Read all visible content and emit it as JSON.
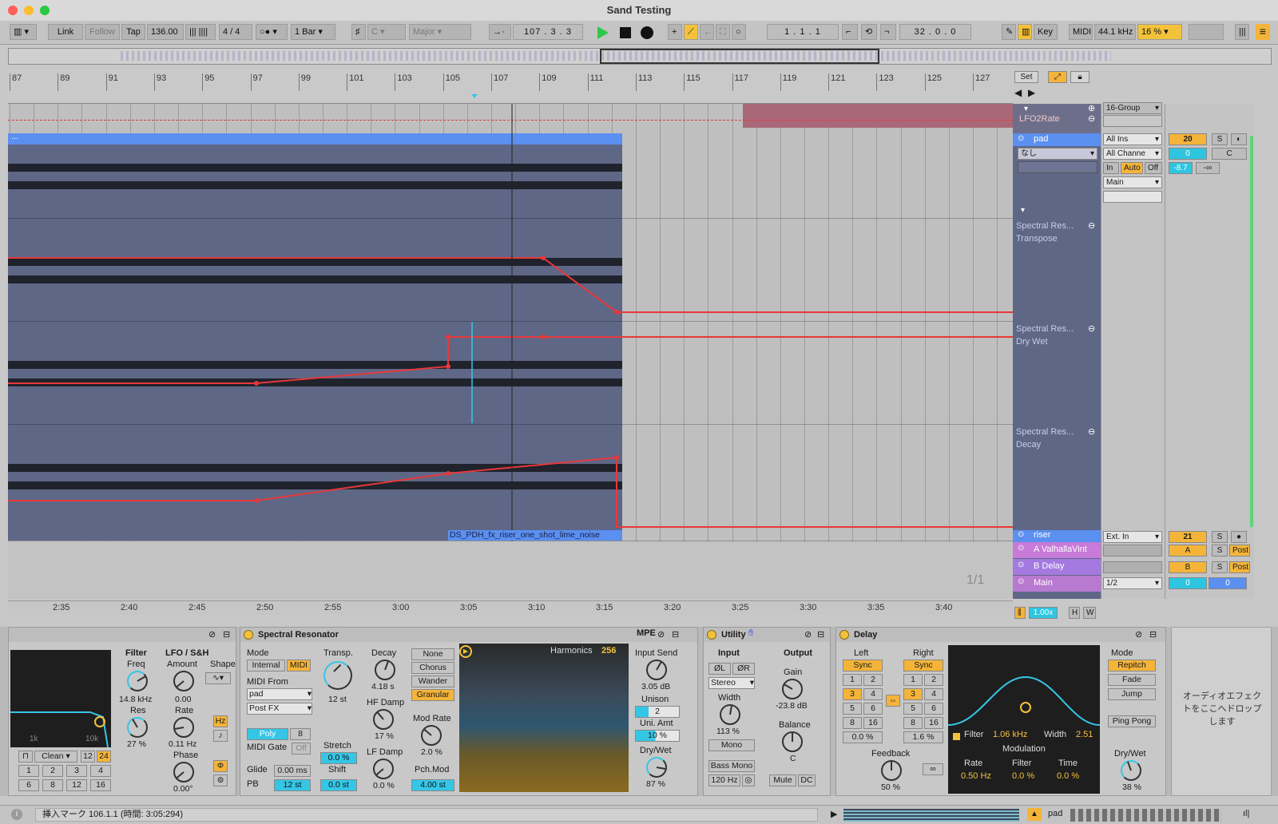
{
  "window": {
    "title": "Sand Testing"
  },
  "control_bar": {
    "link": "Link",
    "follow": "Follow",
    "tap": "Tap",
    "tempo": "136.00",
    "signature": "4 / 4",
    "quantize": "1 Bar",
    "key": "C",
    "scale": "Major",
    "position": "107 .  3 .  3",
    "loop_start": "1 .  1 .  1",
    "loop_length": "32 .  0 .  0",
    "key_btn": "Key",
    "midi_btn": "MIDI",
    "sample_rate": "44.1 kHz",
    "cpu": "16 %"
  },
  "ruler": {
    "bars": [
      "87",
      "89",
      "91",
      "93",
      "95",
      "97",
      "99",
      "101",
      "103",
      "105",
      "107",
      "109",
      "111",
      "113",
      "115",
      "117",
      "119",
      "121",
      "123",
      "125",
      "127"
    ],
    "set": "Set"
  },
  "time_ruler": {
    "times": [
      "2:35",
      "2:40",
      "2:45",
      "2:50",
      "2:55",
      "3:00",
      "3:05",
      "3:10",
      "3:15",
      "3:20",
      "3:25",
      "3:30",
      "3:35",
      "3:40"
    ],
    "page": "1/1"
  },
  "clip": {
    "name": "DS_PDH_fx_riser_one_shot_lime_noise",
    "top_label": "..."
  },
  "tracks": {
    "lfo": {
      "name": "LFO2Rate",
      "io": "16-Group"
    },
    "pad": {
      "name": "pad",
      "input": "All Ins",
      "channel": "All Channe",
      "chain": "なし",
      "monitor_in": "In",
      "monitor_auto": "Auto",
      "monitor_off": "Off",
      "out": "Main",
      "number": "20",
      "vol": "0",
      "pan": "C",
      "meter": "-8.7",
      "peak": "-∞",
      "solo": "S"
    },
    "lanes": [
      {
        "device": "Spectral Res...",
        "param": "Transpose"
      },
      {
        "device": "Spectral Res...",
        "param": "Dry Wet"
      },
      {
        "device": "Spectral Res...",
        "param": "Decay"
      }
    ],
    "riser": {
      "name": "riser",
      "input": "Ext. In",
      "number": "21",
      "solo": "S"
    },
    "returns": [
      {
        "name": "A ValhallaVint",
        "letter": "A",
        "solo": "S",
        "post": "Post"
      },
      {
        "name": "B Delay",
        "letter": "B",
        "solo": "S",
        "post": "Post"
      }
    ],
    "main": {
      "name": "Main",
      "io": "1/2",
      "vol": "0",
      "pan": "0"
    }
  },
  "zoom": {
    "value": "1.00x",
    "h": "H",
    "w": "W"
  },
  "devices": {
    "filter": {
      "filter_label": "Filter",
      "freq_label": "Freq",
      "freq": "14.8 kHz",
      "res_label": "Res",
      "res": "27 %",
      "lfo_label": "LFO / S&H",
      "amount_label": "Amount",
      "amount": "0.00",
      "shape_label": "Shape",
      "rate_label": "Rate",
      "rate": "0.11 Hz",
      "hz": "Hz",
      "phase_label": "Phase",
      "phase": "0.00°",
      "x1k": "1k",
      "x10k": "10k",
      "clean": "Clean",
      "n12": "12",
      "n24": "24",
      "row1": [
        "1",
        "2",
        "3",
        "4"
      ],
      "row2": [
        "6",
        "8",
        "12",
        "16"
      ]
    },
    "spectral": {
      "title": "Spectral Resonator",
      "mode_label": "Mode",
      "internal": "Internal",
      "midi": "MIDI",
      "transp_label": "Transp.",
      "transp": "12 st",
      "decay_label": "Decay",
      "decay": "4.18 s",
      "midi_from_label": "MIDI From",
      "midi_from": "pad",
      "post_fx": "Post FX",
      "hf_label": "HF Damp",
      "hf": "17 %",
      "poly": "Poly",
      "voices": "8",
      "midi_gate_label": "MIDI Gate",
      "midi_gate": "Off",
      "stretch_label": "Stretch",
      "stretch": "0.0 %",
      "lf_label": "LF Damp",
      "lf": "0.0 %",
      "glide_label": "Glide",
      "glide": "0.00 ms",
      "shift_label": "Shift",
      "shift": "0.0 st",
      "pb_label": "PB",
      "pb": "12 st",
      "modes": [
        "None",
        "Chorus",
        "Wander",
        "Granular"
      ],
      "modrate_label": "Mod Rate",
      "modrate": "2.0 %",
      "pchmod_label": "Pch.Mod",
      "pchmod": "4.00 st",
      "harmonics_label": "Harmonics",
      "harmonics": "256",
      "mpe": "MPE",
      "input_send_label": "Input Send",
      "input_send": "3.05 dB",
      "unison_label": "Unison",
      "unison": "2",
      "uniamt_label": "Uni. Amt",
      "uniamt": "10 %",
      "drywet_label": "Dry/Wet",
      "drywet": "87 %"
    },
    "utility": {
      "title": "Utility",
      "input_label": "Input",
      "output_label": "Output",
      "phl": "ØL",
      "phr": "ØR",
      "stereo": "Stereo",
      "gain_label": "Gain",
      "gain": "-23.8 dB",
      "width_label": "Width",
      "width": "113 %",
      "mono": "Mono",
      "balance_label": "Balance",
      "balance": "C",
      "bassmono": "Bass Mono",
      "bassfreq": "120 Hz",
      "mute": "Mute",
      "dc": "DC"
    },
    "delay": {
      "title": "Delay",
      "left_label": "Left",
      "right_label": "Right",
      "sync": "Sync",
      "grid": [
        "1",
        "2",
        "3",
        "4",
        "5",
        "6",
        "8",
        "16"
      ],
      "left_offset": "0.0 %",
      "right_offset": "1.6 %",
      "feedback_label": "Feedback",
      "feedback": "50 %",
      "filter": "Filter",
      "filter_freq": "1.06 kHz",
      "width_label": "Width",
      "width": "2.51",
      "modulation_label": "Modulation",
      "rate_label": "Rate",
      "rate": "0.50 Hz",
      "mfilter_label": "Filter",
      "mfilter": "0.0 %",
      "time_label": "Time",
      "time": "0.0 %",
      "mode_label": "Mode",
      "modes": [
        "Repitch",
        "Fade",
        "Jump"
      ],
      "pingpong": "Ping Pong",
      "drywet_label": "Dry/Wet",
      "drywet": "38 %"
    },
    "drop_hint": "オーディオエフェクトをここへドロップします"
  },
  "status": {
    "text": "挿入マーク 106.1.1 (時間: 3:05:294)",
    "track": "pad"
  },
  "colors": {
    "accent": "#f4c23a",
    "cyan": "#35c6e6",
    "automation": "#e8383a",
    "clip": "#5f6787",
    "selected": "#5b8ff0"
  }
}
